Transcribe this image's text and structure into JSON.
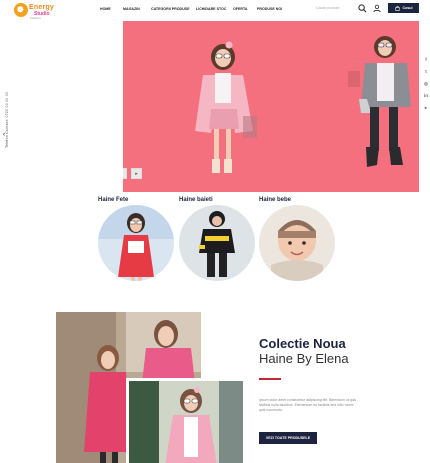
{
  "brand": {
    "name_top": "Energy",
    "name_bottom": "Studio",
    "tagline": "Fashion"
  },
  "nav": {
    "items": [
      "Home",
      "Magazin",
      "Categorii Produse",
      "Lichidare Stoc",
      "Oferta",
      "Produse Noi"
    ]
  },
  "header": {
    "search_placeholder": "Cauta produse",
    "cart_label": "Cosul"
  },
  "side": {
    "contact": "Telefon Contact: 0720 00 00 00"
  },
  "hero": {
    "prev": "◂",
    "next": "▸"
  },
  "categories": [
    {
      "label": "Haine Fete"
    },
    {
      "label": "Haine baieti"
    },
    {
      "label": "Haine bebe"
    }
  ],
  "promo": {
    "title_line1": "Colectie Noua",
    "title_line2": "Haine By Elena",
    "text": "Ipsum dolor amet consectetur adipiscing elit. Bibendum ut quis facilisis nulla faucibus. Elementum eu facilisis sed odio morbi quis commodo.",
    "button": "Vezi toate produsele"
  },
  "colors": {
    "hero_bg": "#f5707e",
    "navy": "#1c2440",
    "accent_red": "#c5283d",
    "logo_orange": "#f08a1e"
  },
  "social_icons": [
    "facebook-icon",
    "twitter-icon",
    "instagram-icon",
    "linkedin-icon",
    "youtube-icon",
    "google-plus-icon"
  ]
}
